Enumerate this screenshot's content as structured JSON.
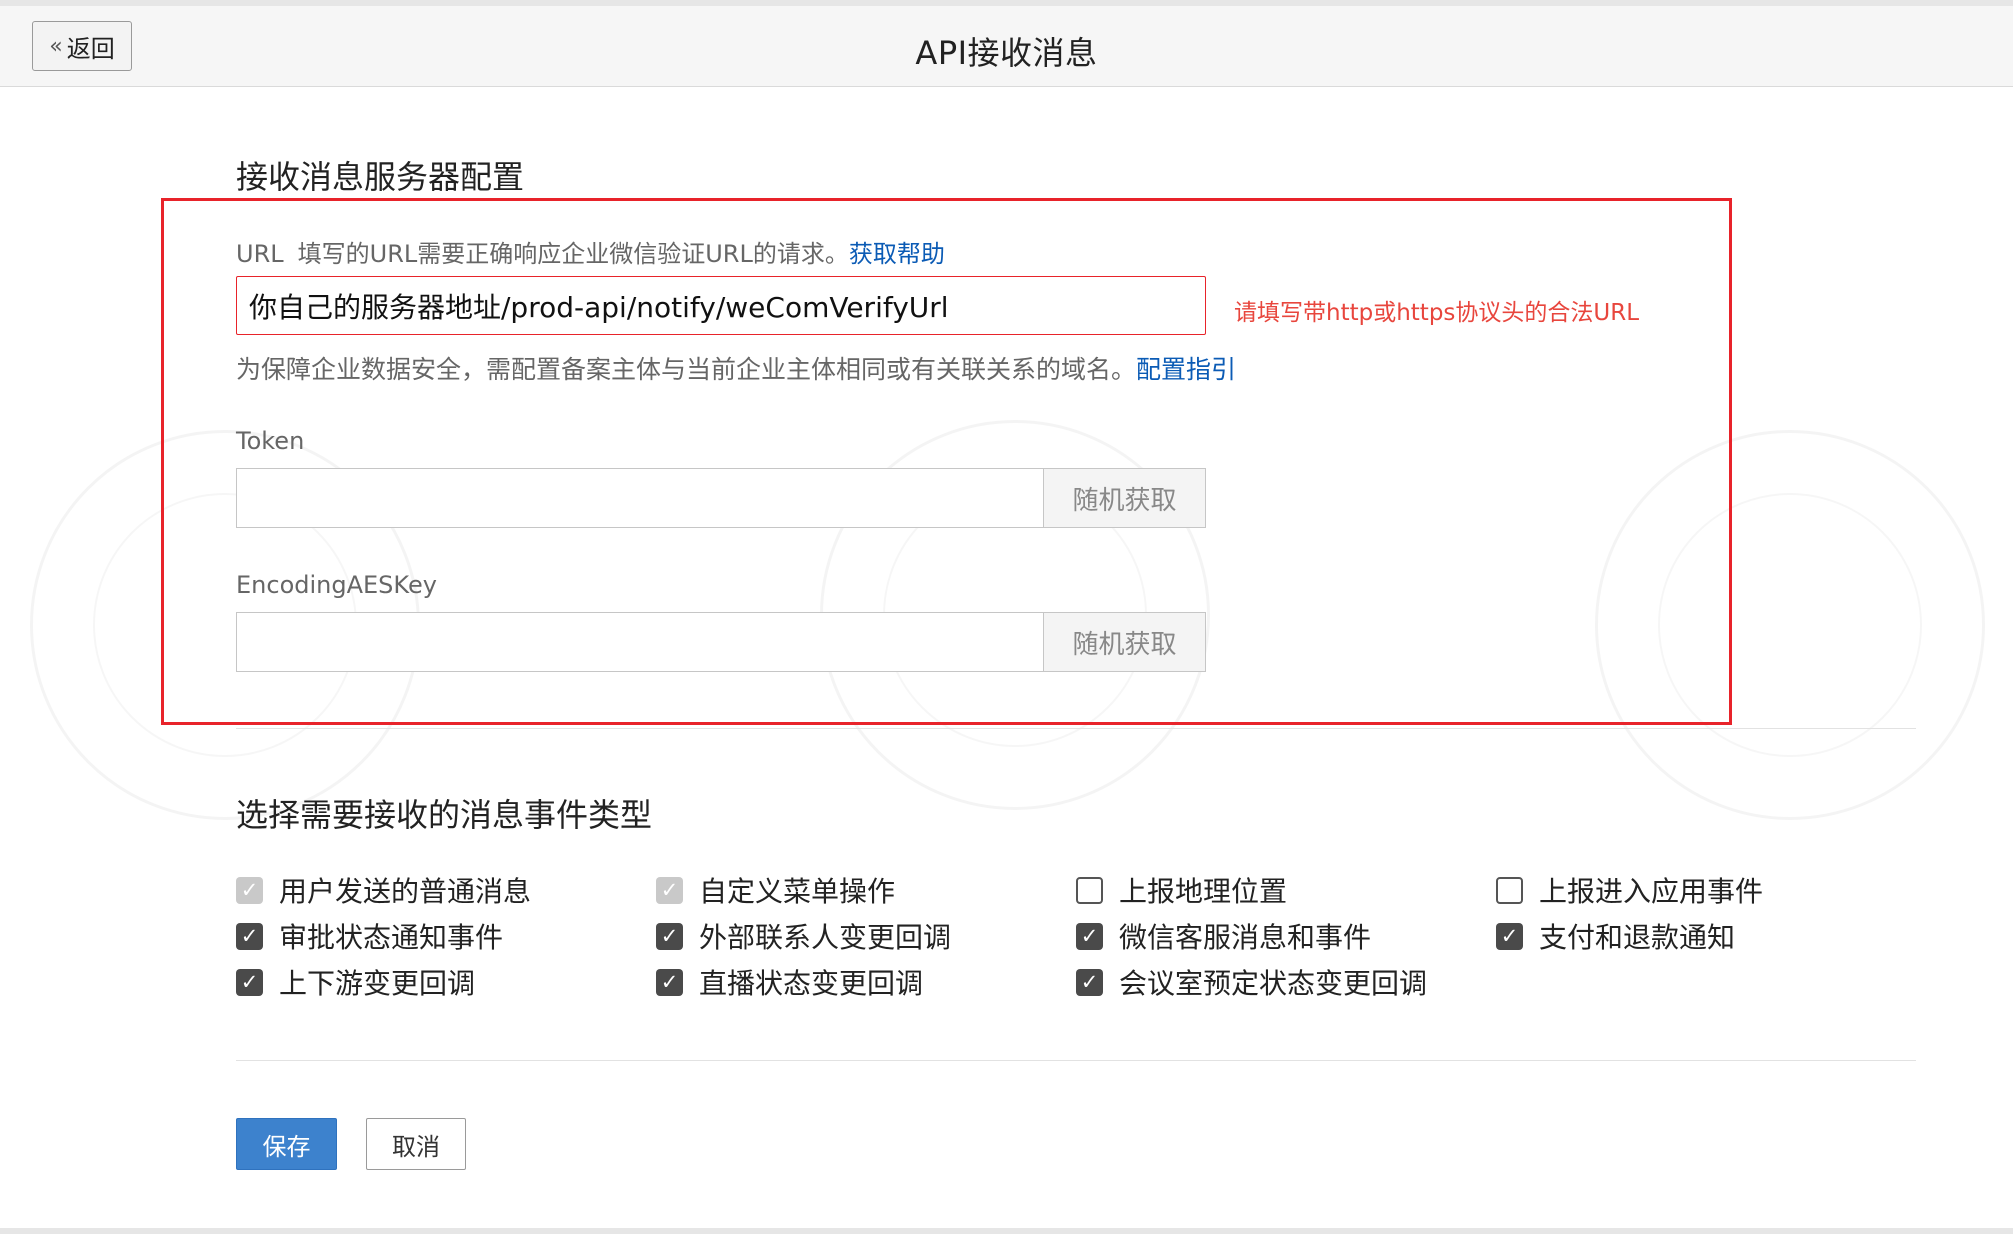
{
  "header": {
    "back_label": "返回",
    "title": "API接收消息"
  },
  "server_config": {
    "title": "接收消息服务器配置",
    "url_label": "URL",
    "url_desc": "填写的URL需要正确响应企业微信验证URL的请求。",
    "url_help_link": "获取帮助",
    "url_value": "你自己的服务器地址/prod-api/notify/weComVerifyUrl",
    "url_error": "请填写带http或https协议头的合法URL",
    "domain_tip": "为保障企业数据安全，需配置备案主体与当前企业主体相同或有关联关系的域名。",
    "domain_tip_link": "配置指引",
    "token_label": "Token",
    "token_value": "",
    "token_random_button": "随机获取",
    "aes_label": "EncodingAESKey",
    "aes_value": "",
    "aes_random_button": "随机获取"
  },
  "events": {
    "title": "选择需要接收的消息事件类型",
    "items": [
      {
        "label": "用户发送的普通消息",
        "state": "checked-disabled"
      },
      {
        "label": "自定义菜单操作",
        "state": "checked-disabled"
      },
      {
        "label": "上报地理位置",
        "state": "unchecked"
      },
      {
        "label": "上报进入应用事件",
        "state": "unchecked"
      },
      {
        "label": "审批状态通知事件",
        "state": "checked"
      },
      {
        "label": "外部联系人变更回调",
        "state": "checked"
      },
      {
        "label": "微信客服消息和事件",
        "state": "checked"
      },
      {
        "label": "支付和退款通知",
        "state": "checked"
      },
      {
        "label": "上下游变更回调",
        "state": "checked"
      },
      {
        "label": "直播状态变更回调",
        "state": "checked"
      },
      {
        "label": "会议室预定状态变更回调",
        "state": "checked"
      }
    ]
  },
  "actions": {
    "save_label": "保存",
    "cancel_label": "取消"
  },
  "colors": {
    "accent": "#3d82cd",
    "error": "#e8232a",
    "link": "#0b5bb5"
  }
}
